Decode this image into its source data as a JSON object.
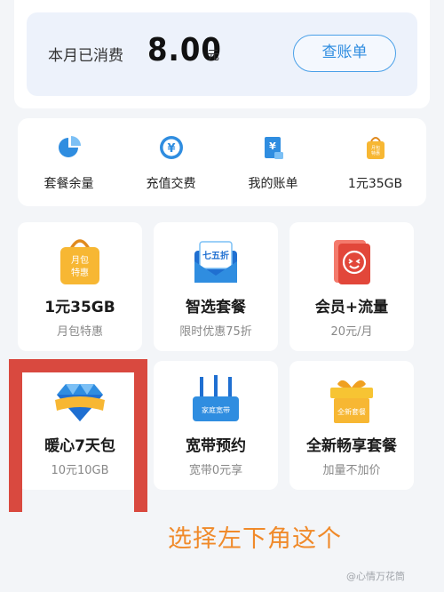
{
  "spend": {
    "label": "本月已消费",
    "amount": "8.00",
    "unit": "元",
    "bill_button": "查账单"
  },
  "quick_actions": [
    {
      "label": "套餐余量",
      "icon": "pie-chart-icon"
    },
    {
      "label": "充值交费",
      "icon": "yuan-recharge-icon"
    },
    {
      "label": "我的账单",
      "icon": "bill-icon"
    },
    {
      "label": "1元35GB",
      "icon": "monthly-bag-icon"
    }
  ],
  "tiles": [
    {
      "title": "1元35GB",
      "subtitle": "月包特惠",
      "icon": "monthly-bag-icon",
      "icon_text": "月包特惠"
    },
    {
      "title": "智选套餐",
      "subtitle": "限时优惠75折",
      "icon": "discount-envelope-icon",
      "icon_text": "七五折"
    },
    {
      "title": "会员+流量",
      "subtitle": "20元/月",
      "icon": "member-card-icon"
    },
    {
      "title": "暖心7天包",
      "subtitle": "10元10GB",
      "icon": "diamond-icon"
    },
    {
      "title": "宽带预约",
      "subtitle": "宽带0元享",
      "icon": "router-icon",
      "icon_text": "家庭宽带"
    },
    {
      "title": "全新畅享套餐",
      "subtitle": "加量不加价",
      "icon": "gift-box-icon",
      "icon_text": "全新套餐"
    }
  ],
  "annotation": {
    "instruction": "选择左下角这个",
    "watermark": "@心情万花筒"
  },
  "colors": {
    "accent_blue": "#2f8de0",
    "highlight_red": "#d9493f",
    "instruction_orange": "#f08a2a",
    "icon_gold": "#f7b733"
  }
}
